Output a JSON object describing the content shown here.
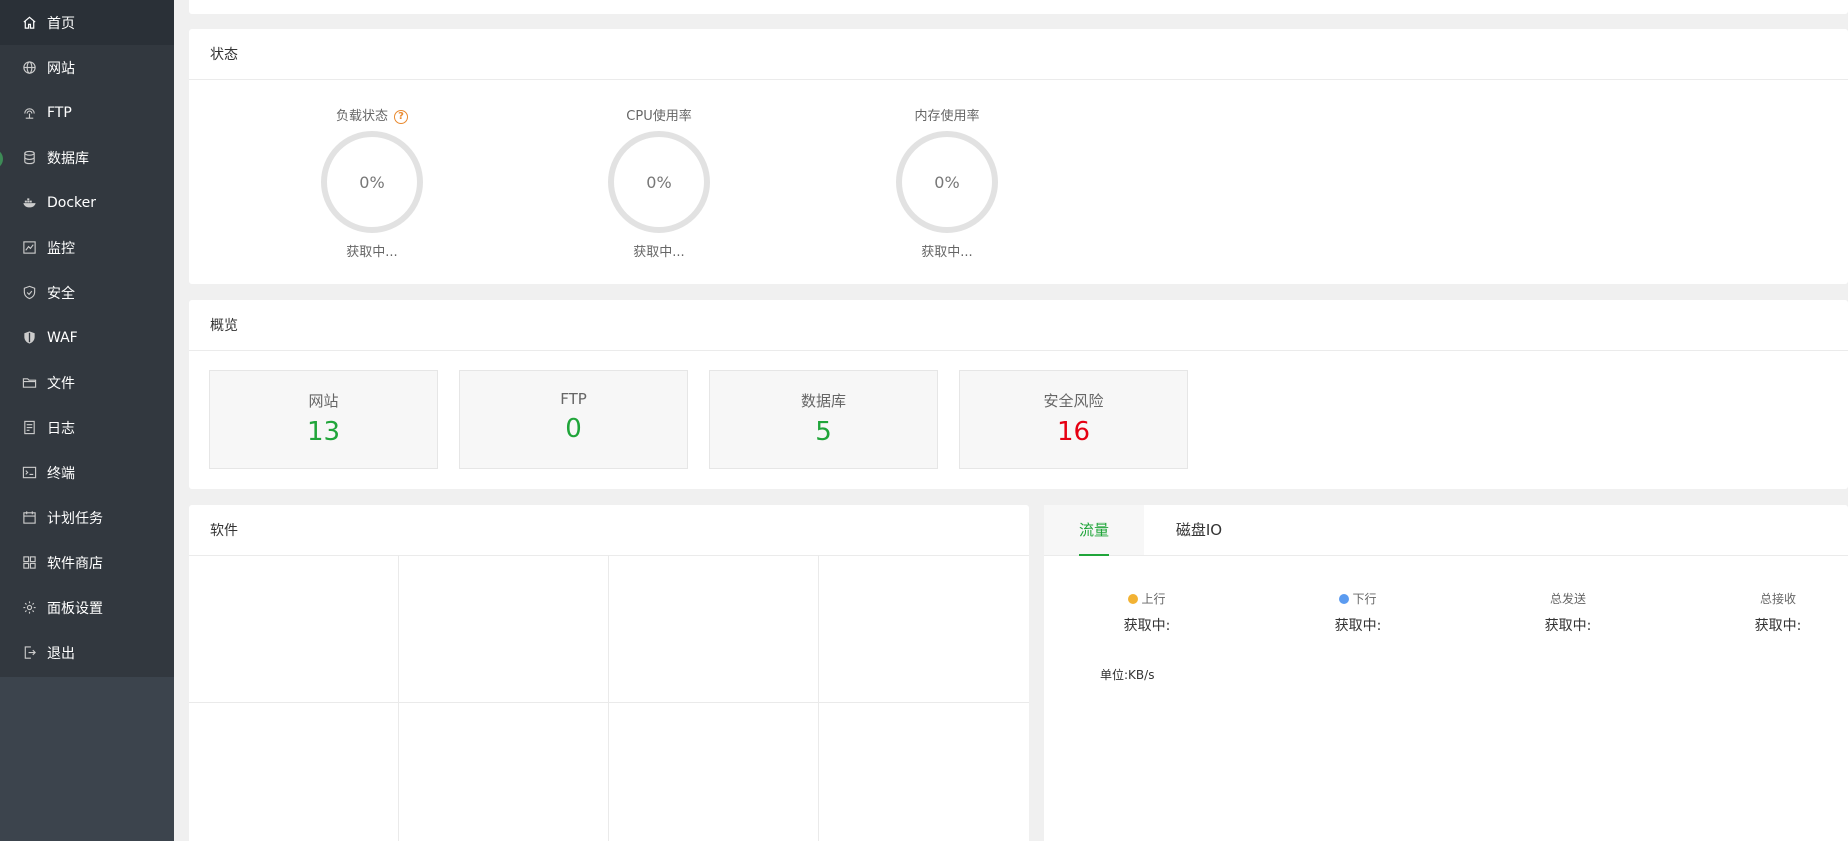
{
  "sidebar": {
    "items": [
      {
        "label": "首页",
        "icon": "home-icon"
      },
      {
        "label": "网站",
        "icon": "globe-icon"
      },
      {
        "label": "FTP",
        "icon": "ftp-icon"
      },
      {
        "label": "数据库",
        "icon": "database-icon"
      },
      {
        "label": "Docker",
        "icon": "docker-icon"
      },
      {
        "label": "监控",
        "icon": "monitor-icon"
      },
      {
        "label": "安全",
        "icon": "shield-icon"
      },
      {
        "label": "WAF",
        "icon": "waf-icon"
      },
      {
        "label": "文件",
        "icon": "folder-icon"
      },
      {
        "label": "日志",
        "icon": "log-icon"
      },
      {
        "label": "终端",
        "icon": "terminal-icon"
      },
      {
        "label": "计划任务",
        "icon": "calendar-icon"
      },
      {
        "label": "软件商店",
        "icon": "store-icon"
      },
      {
        "label": "面板设置",
        "icon": "gear-icon"
      },
      {
        "label": "退出",
        "icon": "logout-icon"
      }
    ]
  },
  "status": {
    "title": "状态",
    "gauges": [
      {
        "title": "负载状态",
        "value": "0%",
        "status": "获取中..."
      },
      {
        "title": "CPU使用率",
        "value": "0%",
        "status": "获取中..."
      },
      {
        "title": "内存使用率",
        "value": "0%",
        "status": "获取中..."
      }
    ],
    "help_glyph": "?"
  },
  "overview": {
    "title": "概览",
    "boxes": [
      {
        "label": "网站",
        "value": "13"
      },
      {
        "label": "FTP",
        "value": "0"
      },
      {
        "label": "数据库",
        "value": "5"
      },
      {
        "label": "安全风险",
        "value": "16"
      }
    ]
  },
  "software": {
    "title": "软件"
  },
  "traffic": {
    "tabs": [
      {
        "label": "流量"
      },
      {
        "label": "磁盘IO"
      }
    ],
    "stats": [
      {
        "label": "上行",
        "value": "获取中:",
        "dot_color": "#f2b233"
      },
      {
        "label": "下行",
        "value": "获取中:",
        "dot_color": "#5b9bf0"
      },
      {
        "label": "总发送",
        "value": "获取中:"
      },
      {
        "label": "总接收",
        "value": "获取中:"
      }
    ],
    "unit": "单位:KB/s"
  },
  "colors": {
    "accent": "#20a53a",
    "danger": "#e60012",
    "sidebar": "#32383f"
  }
}
